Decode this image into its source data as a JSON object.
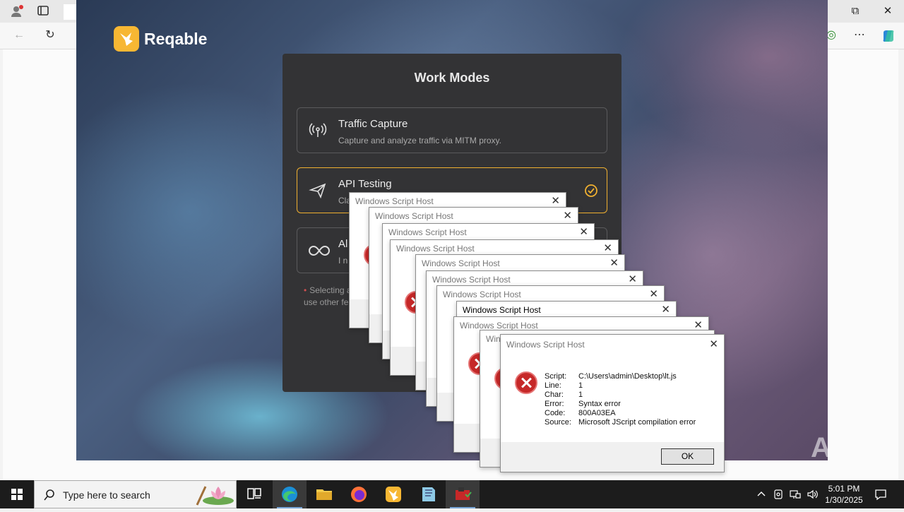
{
  "browser": {
    "icons": [
      "profile-icon",
      "tab-actions-icon",
      "back-icon",
      "refresh-icon",
      "more-icon",
      "copilot-icon"
    ],
    "win_controls": {
      "restore": "⧉",
      "close": "✕"
    }
  },
  "reqable": {
    "brand": "Reqable",
    "title": "Work Modes",
    "modes": [
      {
        "title": "Traffic Capture",
        "desc": "Capture and analyze traffic via MITM proxy.",
        "icon": "antenna-icon",
        "selected": false
      },
      {
        "title": "API Testing",
        "desc": "Cla",
        "icon": "paper-plane-icon",
        "selected": true
      },
      {
        "title": "Al",
        "desc": "I n",
        "icon": "infinity-icon",
        "selected": false
      }
    ],
    "note_line1": "Selecting a",
    "note_line2": "use other fe"
  },
  "dialogs": {
    "title": "Windows Script Host",
    "close": "✕",
    "script_label": "Script:",
    "script_value": "C:\\Users\\admin\\Desktop\\lt.js",
    "line_label": "Line:",
    "line_value": "1",
    "char_label": "Char:",
    "char_value": "1",
    "error_label": "Error:",
    "error_value": "Syntax error",
    "code_label": "Code:",
    "code_value": "800A03EA",
    "source_label": "Source:",
    "source_value": "Microsoft JScript compilation error",
    "ok": "OK"
  },
  "taskbar": {
    "search_placeholder": "Type here to search",
    "time": "5:01 PM",
    "date": "1/30/2025"
  },
  "watermark": "ANY RUN"
}
